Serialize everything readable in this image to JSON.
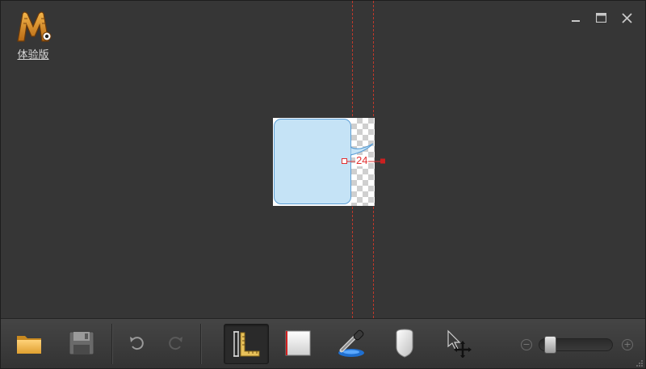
{
  "app": {
    "logo_label": "体验版"
  },
  "window_controls": {
    "minimize": "minimize-icon",
    "maximize": "maximize-icon",
    "close": "close-icon"
  },
  "canvas": {
    "measurement": "24"
  },
  "toolbar": {
    "tools": [
      "open-folder-icon",
      "save-icon",
      "undo-icon",
      "redo-icon",
      "ruler-icon",
      "frame-icon",
      "eyedropper-icon",
      "color-swatch-icon",
      "move-cursor-icon"
    ],
    "active_tool": "ruler-icon",
    "zoom_level": 0.05
  },
  "colors": {
    "guide": "#c0392b",
    "bubble_fill": "#c5e3f6",
    "bubble_stroke": "#5c9fd6",
    "measure": "#e03030"
  }
}
